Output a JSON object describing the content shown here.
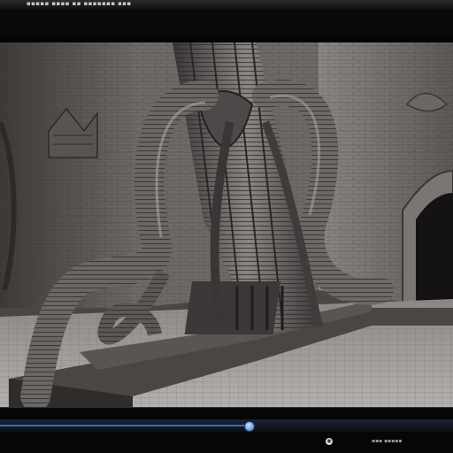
{
  "window": {
    "title_glyphs": "▪▪▪▪▪  ▪▪▪▪ ▪▪  ▪▪▪▪▪▪▪  ▪▪▪"
  },
  "viewer": {
    "image_alt": "",
    "accent_color": "#3b6fb6"
  },
  "playback": {
    "progress_fraction": 0.55
  },
  "tray": {
    "icon": "globe-icon",
    "text_glyphs": "▪▪▪  ▪▪▪▪▪"
  }
}
